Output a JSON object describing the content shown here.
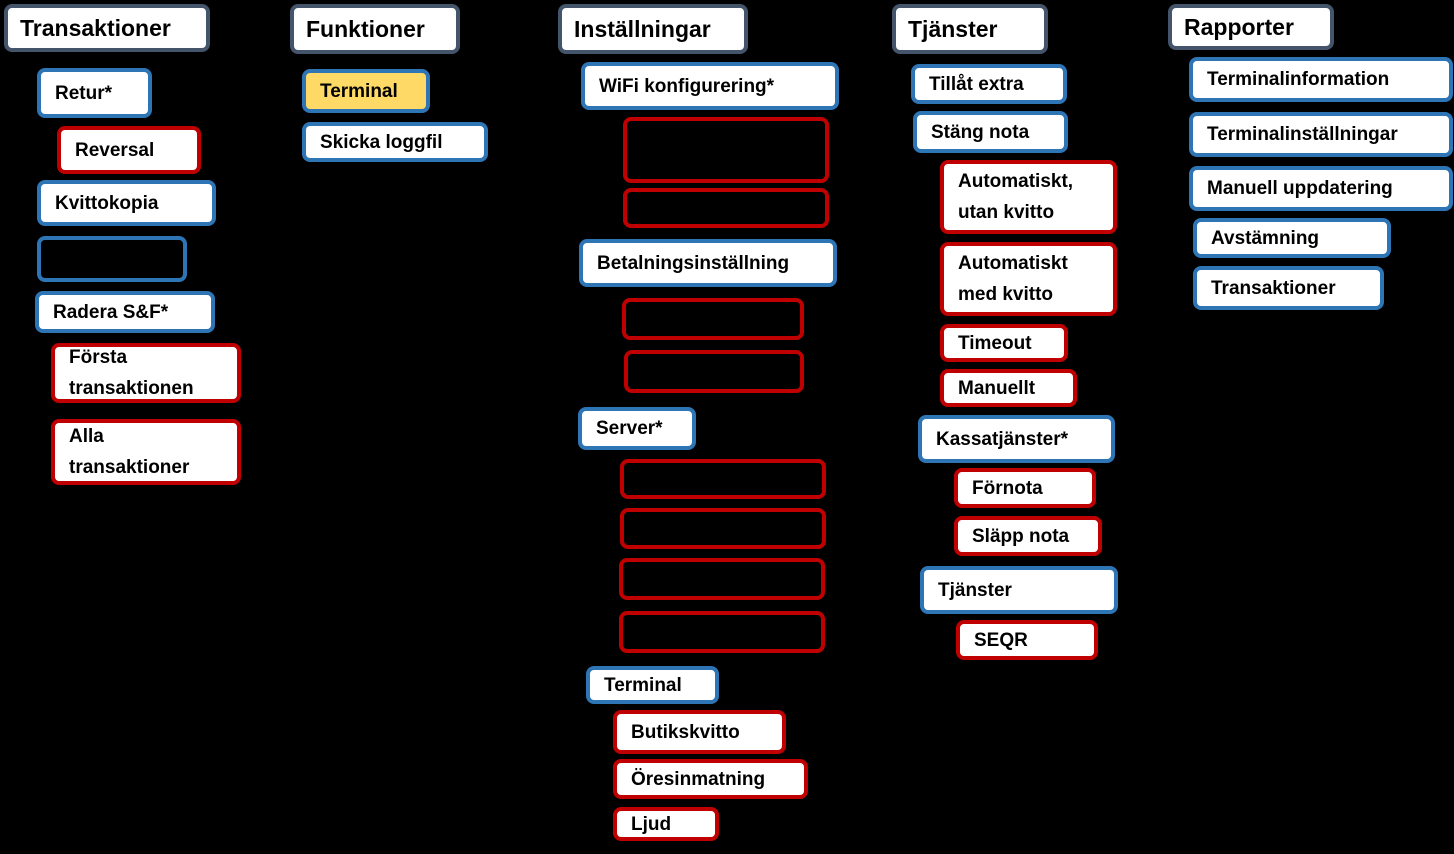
{
  "colors": {
    "header_border": "#44546a",
    "blue_border": "#2e75b6",
    "red_border": "#c00000",
    "highlight_fill": "#ffd966",
    "background": "#000000"
  },
  "columns": [
    {
      "header": "Transaktioner",
      "items": [
        "Retur*",
        "Reversal",
        "Kvittokopia",
        "Radera S&F*",
        "Första\ntransaktionen",
        "Alla\ntransaktioner"
      ]
    },
    {
      "header": "Funktioner",
      "items": [
        "Terminal",
        "Skicka loggfil"
      ]
    },
    {
      "header": "Inställningar",
      "items": [
        "WiFi konfigurering*",
        "Betalningsinställning",
        "Server*",
        "Terminal",
        "Butikskvitto",
        "Öresinmatning",
        "Ljud"
      ]
    },
    {
      "header": "Tjänster",
      "items": [
        "Tillåt extra",
        "Stäng nota",
        "Automatiskt,\nutan kvitto",
        "Automatiskt\nmed kvitto",
        "Timeout",
        "Manuellt",
        "Kassatjänster*",
        "Förnota",
        "Släpp nota",
        "Tjänster",
        "SEQR"
      ]
    },
    {
      "header": "Rapporter",
      "items": [
        "Terminalinformation",
        "Terminalinställningar",
        "Manuell uppdatering",
        "Avstämning",
        "Transaktioner"
      ]
    }
  ]
}
